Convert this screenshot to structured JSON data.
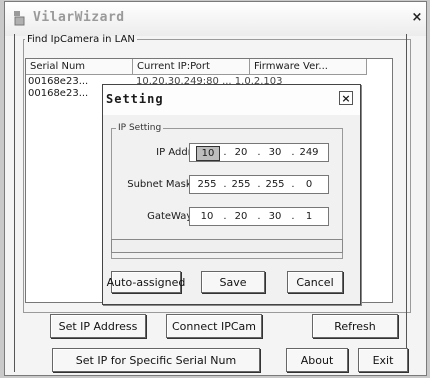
{
  "window": {
    "title": "VilarWizard",
    "close_glyph": "×",
    "icon": "app-icon"
  },
  "lan_group": {
    "legend": "Find IpCamera in LAN",
    "columns": [
      "Serial Num",
      "Current IP:Port",
      "Firmware Ver..."
    ],
    "rows": [
      {
        "serial": "00168e23...",
        "rest": "10.20.30.249:80 ... 1.0.2.103"
      },
      {
        "serial": "00168e23..."
      }
    ]
  },
  "buttons": {
    "set_ip": "Set IP Address",
    "connect": "Connect IPCam",
    "refresh": "Refresh",
    "set_ip_serial": "Set IP for Specific Serial Num",
    "about": "About",
    "exit": "Exit"
  },
  "dialog": {
    "title": "Setting",
    "close_glyph": "×",
    "group_legend": "IP Setting",
    "ip_label": "IP Addr:",
    "ip": [
      "10",
      "20",
      "30",
      "249"
    ],
    "mask_label": "Subnet Mask:",
    "mask": [
      "255",
      "255",
      "255",
      "0"
    ],
    "gw_label": "GateWay:",
    "gw": [
      "10",
      "20",
      "30",
      "1"
    ],
    "auto_btn": "Auto-assigned",
    "save_btn": "Save",
    "cancel_btn": "Cancel"
  }
}
